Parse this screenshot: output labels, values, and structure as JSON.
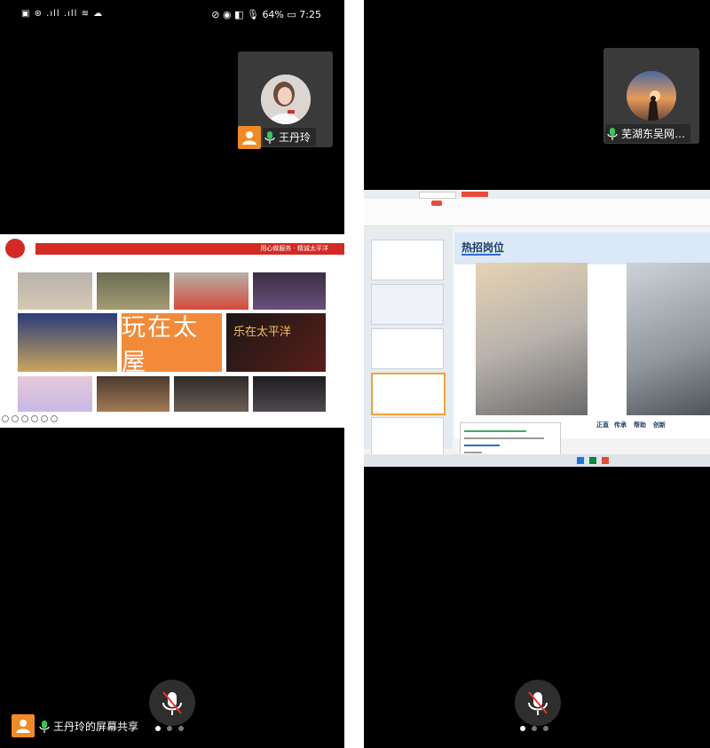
{
  "left": {
    "status": {
      "left_icons": "▣ ⊛ .ıll .ıll ≋ ☁",
      "right_icons": "⊘ ◉ ◧ 🎙",
      "battery": "64%",
      "time": "7:25"
    },
    "participant_name": "王丹玲",
    "slide": {
      "header_text": "用心做服务 · 精诚太平洋",
      "big_text": "玩在太屋",
      "banner_text": "乐在太平洋"
    },
    "share_label": "王丹玲的屏幕共享",
    "page_dots": 3,
    "active_dot": 0
  },
  "right": {
    "participant_name": "芜湖东吴网…",
    "slide": {
      "title": "热招岗位",
      "keywords": [
        "正直",
        "传承",
        "帮助",
        "创新"
      ]
    },
    "page_dots": 3,
    "active_dot": 0
  },
  "colors": {
    "orange": "#f08a24",
    "red": "#d42a23",
    "mic_green": "#34c759"
  }
}
